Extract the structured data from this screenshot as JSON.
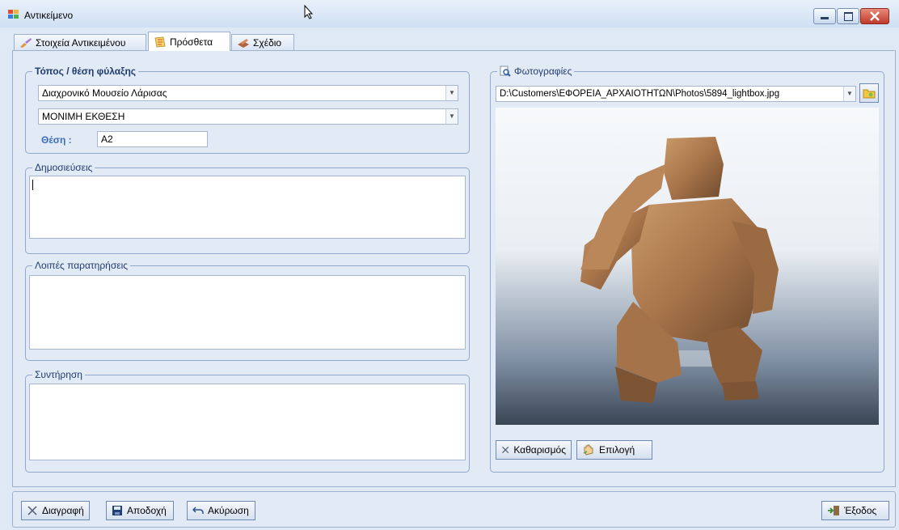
{
  "window": {
    "title": "Αντικείμενο"
  },
  "tabs": [
    {
      "label": "Στοιχεία Αντικειμένου"
    },
    {
      "label": "Πρόσθετα"
    },
    {
      "label": "Σχέδιο"
    }
  ],
  "storage": {
    "legend": "Τόπος / θέση φύλαξης",
    "museum": "Διαχρονικό Μουσείο Λάρισας",
    "section": "ΜΟΝΙΜΗ ΕΚΘΕΣΗ",
    "position_label": "Θέση :",
    "position_value": "A2"
  },
  "publications": {
    "legend": "Δημοσιεύσεις"
  },
  "remarks": {
    "legend": "Λοιπές παρατηρήσεις"
  },
  "conservation": {
    "legend": "Συντήρηση"
  },
  "photos": {
    "legend": "Φωτογραφίες",
    "path": "D:\\Customers\\ΕΦΟΡΕΙΑ_ΑΡΧΑΙΟΤΗΤΩΝ\\Photos\\5894_lightbox.jpg",
    "clear_label": "Καθαρισμός",
    "select_label": "Επιλογή"
  },
  "footer": {
    "delete_label": "Διαγραφή",
    "accept_label": "Αποδοχή",
    "cancel_label": "Ακύρωση",
    "exit_label": "Έξοδος"
  }
}
